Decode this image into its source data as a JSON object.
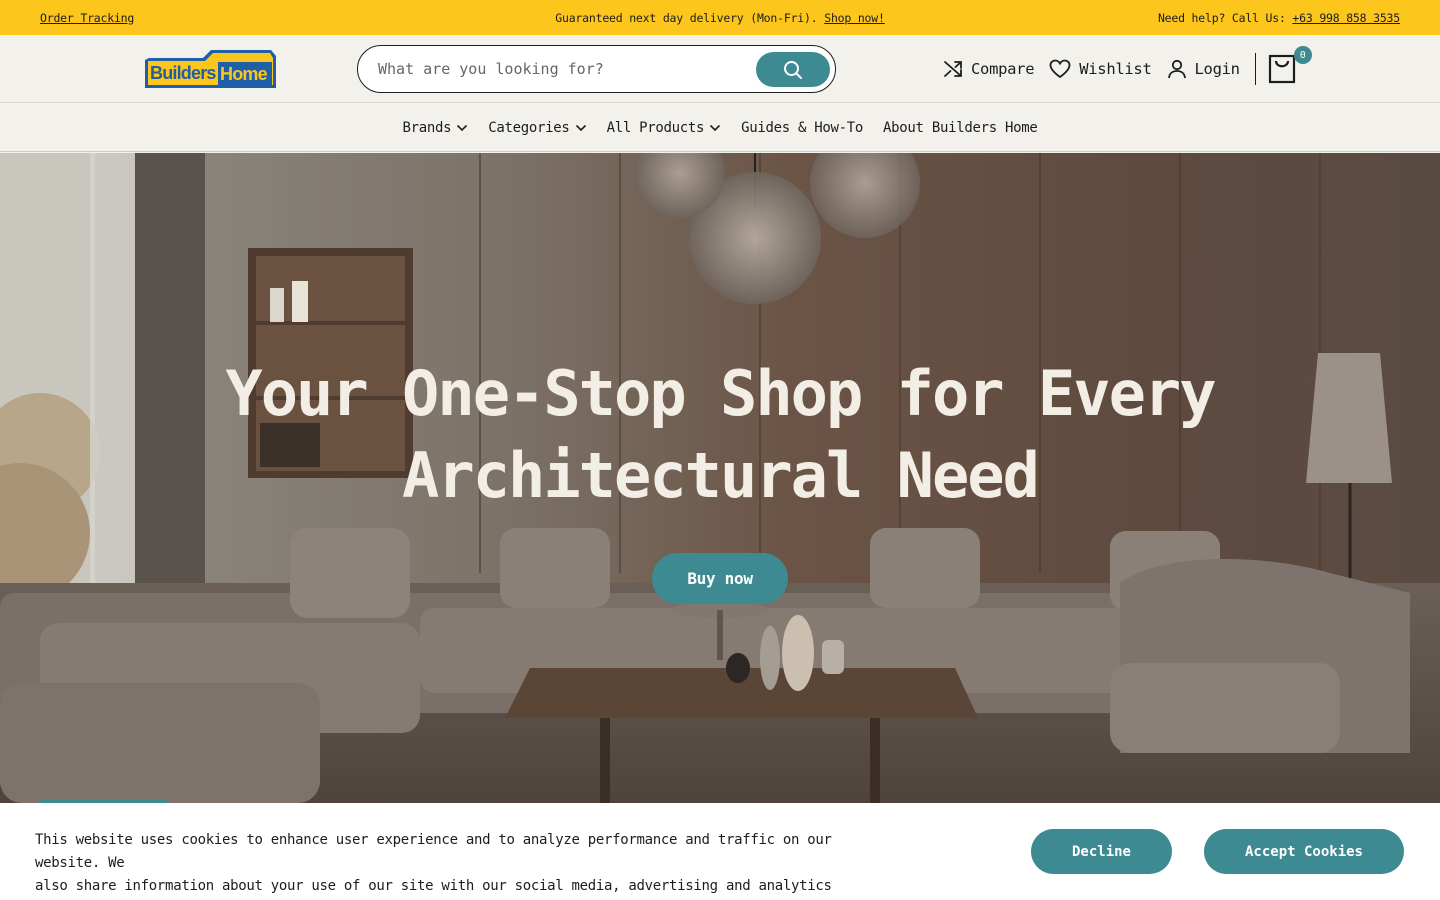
{
  "topbar": {
    "left_link": "Order Tracking",
    "center_text": "Guaranteed next day delivery (Mon-Fri).",
    "center_link": "Shop now!",
    "right_text": "Need help? Call Us:",
    "right_phone": "+63 998 858 3535"
  },
  "header": {
    "logo_text_1": "Builders",
    "logo_text_2": "Home",
    "search_placeholder": "What are you looking for?",
    "compare_label": "Compare",
    "wishlist_label": "Wishlist",
    "login_label": "Login",
    "cart_count": "0"
  },
  "nav": {
    "items": [
      {
        "label": "Brands",
        "dropdown": true
      },
      {
        "label": "Categories",
        "dropdown": true
      },
      {
        "label": "All Products",
        "dropdown": true
      },
      {
        "label": "Guides & How-To",
        "dropdown": false
      },
      {
        "label": "About Builders Home",
        "dropdown": false
      }
    ]
  },
  "hero": {
    "title_line_1": "Your One-Stop Shop for Every",
    "title_line_2": "Architectural Need",
    "cta_label": "Buy now"
  },
  "cookie": {
    "text_line_1": "This website uses cookies to enhance user experience and to analyze performance and traffic on our website. We",
    "text_line_2": "also share information about your use of our site with our social media, advertising and analytics partners.",
    "decline_label": "Decline",
    "accept_label": "Accept Cookies"
  },
  "colors": {
    "accent_yellow": "#fcc61d",
    "teal": "#3e8a92",
    "background": "#f3f1ec",
    "logo_blue": "#1f5fa8"
  }
}
